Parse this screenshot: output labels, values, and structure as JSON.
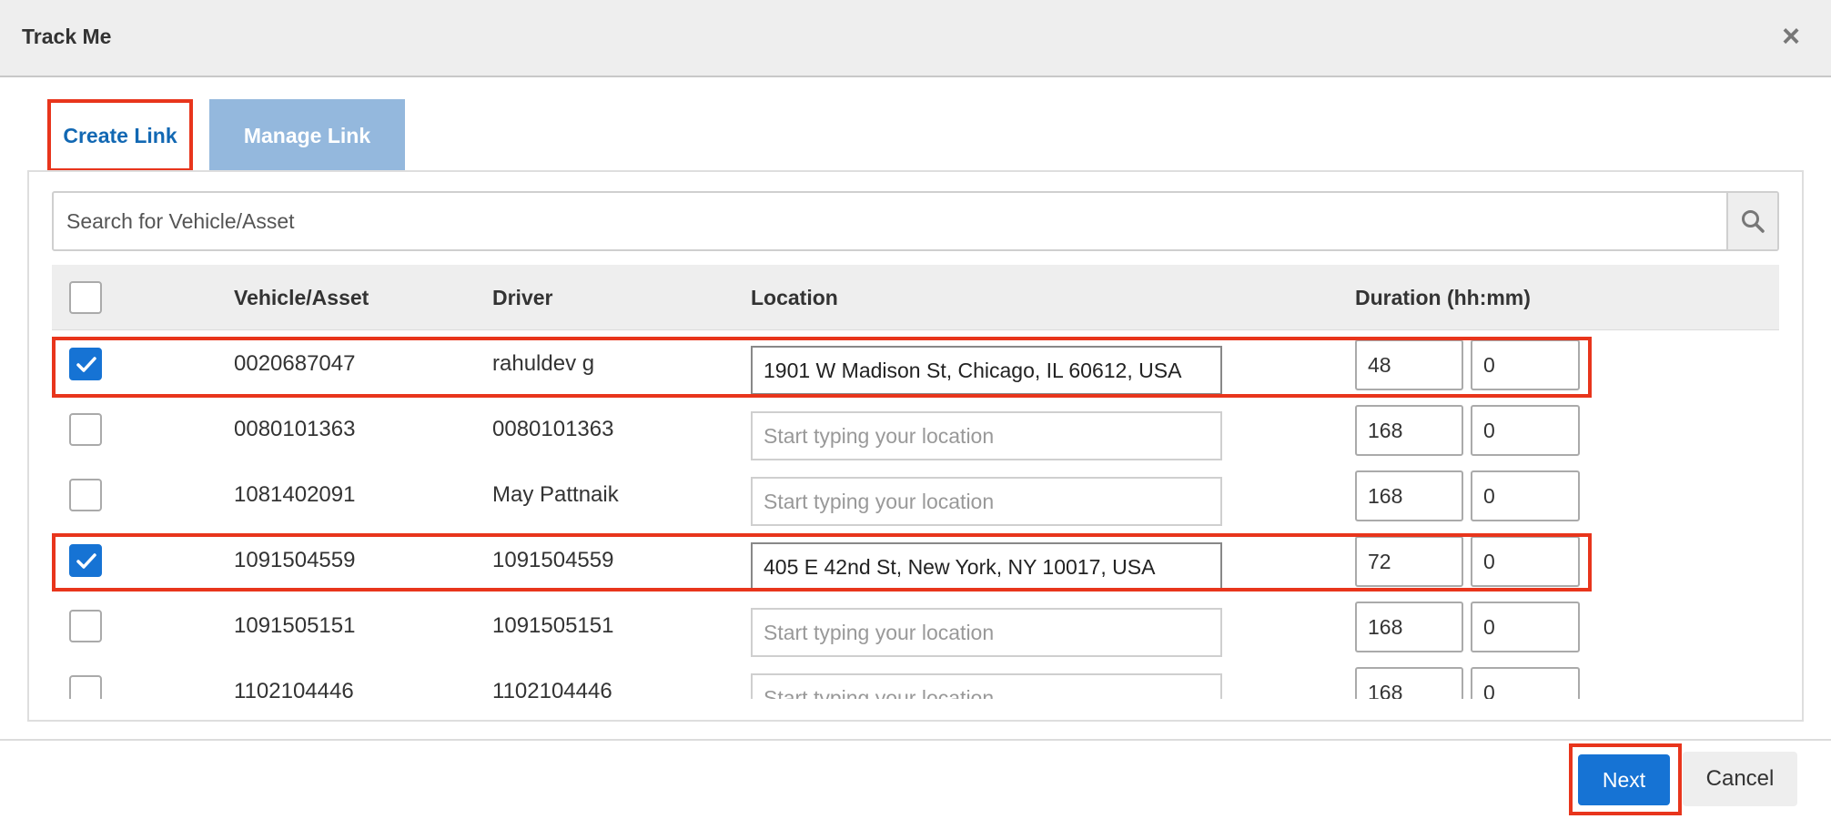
{
  "dialog": {
    "title": "Track Me",
    "close_symbol": "×"
  },
  "tabs": [
    {
      "label": "Create Link",
      "active": true
    },
    {
      "label": "Manage Link",
      "active": false
    }
  ],
  "search": {
    "placeholder": "Search for Vehicle/Asset",
    "value": "",
    "icon": "search-icon"
  },
  "table": {
    "columns": {
      "vehicle": "Vehicle/Asset",
      "driver": "Driver",
      "location": "Location",
      "duration": "Duration (hh:mm)"
    },
    "location_placeholder": "Start typing your location",
    "rows": [
      {
        "checked": true,
        "vehicle": "0020687047",
        "driver": "rahuldev g",
        "location": "1901 W Madison St, Chicago, IL 60612, USA",
        "hours": "48",
        "minutes": "0"
      },
      {
        "checked": false,
        "vehicle": "0080101363",
        "driver": "0080101363",
        "location": "",
        "hours": "168",
        "minutes": "0"
      },
      {
        "checked": false,
        "vehicle": "1081402091",
        "driver": "May Pattnaik",
        "location": "",
        "hours": "168",
        "minutes": "0"
      },
      {
        "checked": true,
        "vehicle": "1091504559",
        "driver": "1091504559",
        "location": "405 E 42nd St, New York, NY 10017, USA",
        "hours": "72",
        "minutes": "0"
      },
      {
        "checked": false,
        "vehicle": "1091505151",
        "driver": "1091505151",
        "location": "",
        "hours": "168",
        "minutes": "0"
      },
      {
        "checked": false,
        "vehicle": "1102104446",
        "driver": "1102104446",
        "location": "",
        "hours": "168",
        "minutes": "0"
      }
    ]
  },
  "footer": {
    "next_label": "Next",
    "cancel_label": "Cancel"
  },
  "colors": {
    "primary": "#1673d4",
    "highlight": "#e8351c",
    "tab_inactive": "#94b8dd",
    "header_bg": "#eeeeee"
  }
}
